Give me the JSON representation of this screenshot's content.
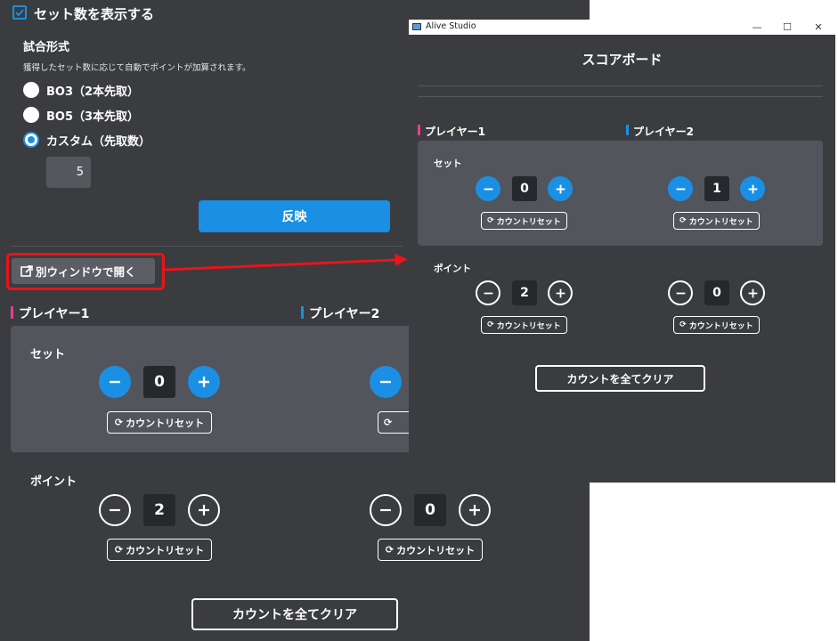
{
  "settings": {
    "show_sets_label": "セット数を表示する",
    "match_format_title": "試合形式",
    "match_format_desc": "獲得したセット数に応じて自動でポイントが加算されます。",
    "options": [
      {
        "label": "BO3（2本先取）",
        "selected": false
      },
      {
        "label": "BO5（3本先取）",
        "selected": false
      },
      {
        "label": "カスタム（先取数）",
        "selected": true
      }
    ],
    "custom_value": "5",
    "apply_label": "反映",
    "open_window_label": "別ウィンドウで開く"
  },
  "players": {
    "p1_name": "プレイヤー1",
    "p2_name": "プレイヤー2",
    "p1_color": "#e83e8c",
    "p2_color": "#1a8fe3"
  },
  "labels": {
    "set": "セット",
    "point": "ポイント",
    "reset": "カウントリセット",
    "clear_all": "カウントを全てクリア"
  },
  "main_scores": {
    "p1_set": "0",
    "p1_point": "2",
    "p2_point": "0"
  },
  "popup": {
    "app_title": "Alive Studio",
    "heading": "スコアボード",
    "p1_set": "0",
    "p2_set": "1",
    "p1_point": "2",
    "p2_point": "0"
  },
  "colors": {
    "accent": "#1a8fe3",
    "highlight": "#e8151b",
    "background": "#3a3c40",
    "panel": "#52555c"
  }
}
